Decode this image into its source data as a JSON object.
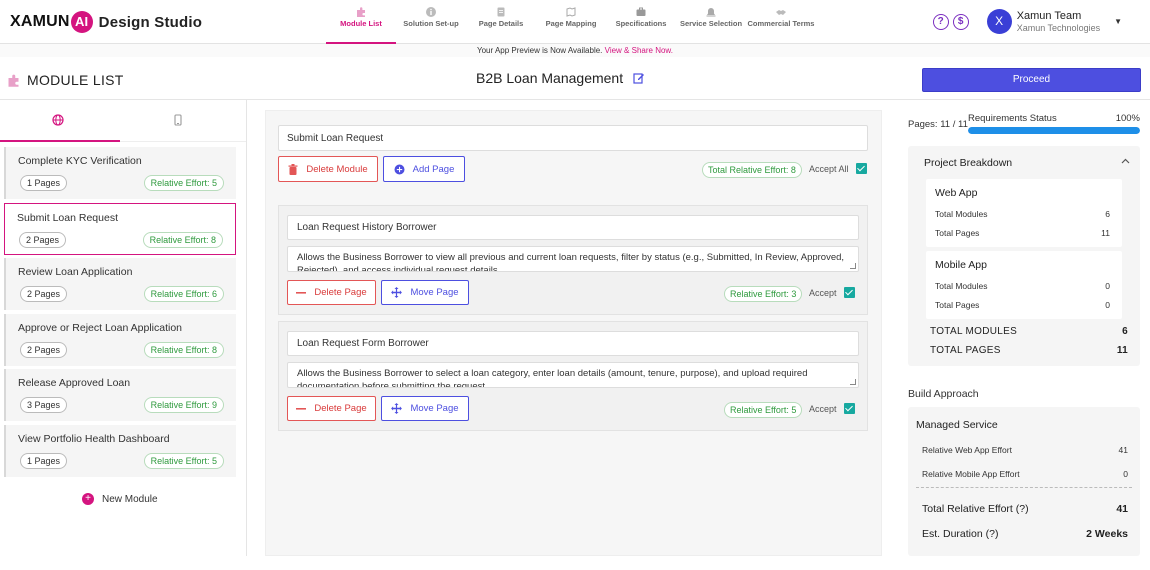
{
  "brand": {
    "name_part": "XAMUN",
    "ai_part": "AI",
    "suffix": "Design Studio"
  },
  "steps": [
    {
      "label": "Module List",
      "icon": "puzzle-icon",
      "active": true
    },
    {
      "label": "Solution Set-up",
      "icon": "info-icon",
      "active": false
    },
    {
      "label": "Page Details",
      "icon": "document-icon",
      "active": false
    },
    {
      "label": "Page Mapping",
      "icon": "map-icon",
      "active": false
    },
    {
      "label": "Specifications",
      "icon": "briefcase-icon",
      "active": false
    },
    {
      "label": "Service Selection",
      "icon": "bell-icon",
      "active": false
    },
    {
      "label": "Commercial Terms",
      "icon": "handshake-icon",
      "active": false
    }
  ],
  "user": {
    "initial": "X",
    "name": "Xamun Team",
    "org": "Xamun Technologies"
  },
  "banner": {
    "text": "Your App Preview is Now Available.",
    "link": "View & Share Now."
  },
  "header": {
    "module_list_title": "MODULE LIST",
    "project_title": "B2B Loan Management",
    "proceed_label": "Proceed"
  },
  "left": {
    "modules": [
      {
        "name": "Complete KYC Verification",
        "pages": "1 Pages",
        "effort": "Relative Effort: 5"
      },
      {
        "name": "Submit Loan Request",
        "pages": "2 Pages",
        "effort": "Relative Effort: 8"
      },
      {
        "name": "Review Loan Application",
        "pages": "2 Pages",
        "effort": "Relative Effort: 6"
      },
      {
        "name": "Approve or Reject Loan Application",
        "pages": "2 Pages",
        "effort": "Relative Effort: 8"
      },
      {
        "name": "Release Approved Loan",
        "pages": "3 Pages",
        "effort": "Relative Effort: 9"
      },
      {
        "name": "View Portfolio Health Dashboard",
        "pages": "1 Pages",
        "effort": "Relative Effort: 5"
      }
    ],
    "new_module_label": "New Module"
  },
  "editor": {
    "module_name": "Submit Loan Request",
    "delete_module_label": "Delete Module",
    "add_page_label": "Add Page",
    "total_effort": "Total Relative Effort: 8",
    "accept_all_label": "Accept All",
    "pages": [
      {
        "title": "Loan Request History Borrower",
        "description": "Allows the Business Borrower to view all previous and current loan requests, filter by status (e.g., Submitted, In Review, Approved, Rejected), and access individual request details.",
        "delete_label": "Delete Page",
        "move_label": "Move Page",
        "effort": "Relative Effort: 3",
        "accept_label": "Accept"
      },
      {
        "title": "Loan Request Form Borrower",
        "description": "Allows the Business Borrower to select a loan category, enter loan details (amount, tenure, purpose), and upload required documentation before submitting the request.",
        "delete_label": "Delete Page",
        "move_label": "Move Page",
        "effort": "Relative Effort: 5",
        "accept_label": "Accept"
      }
    ]
  },
  "right": {
    "pages_count": "Pages: 11 / 11",
    "req_label": "Requirements Status",
    "req_pct": "100%",
    "req_fraction": 1.0,
    "breakdown_title": "Project Breakdown",
    "web": {
      "title": "Web App",
      "modules_label": "Total Modules",
      "modules": "6",
      "pages_label": "Total Pages",
      "pages": "11"
    },
    "mobile": {
      "title": "Mobile App",
      "modules_label": "Total Modules",
      "modules": "0",
      "pages_label": "Total Pages",
      "pages": "0"
    },
    "total_modules_label": "TOTAL MODULES",
    "total_modules": "6",
    "total_pages_label": "TOTAL PAGES",
    "total_pages": "11",
    "build_approach_label": "Build Approach",
    "managed_service_label": "Managed Service",
    "web_effort_label": "Relative Web App Effort",
    "web_effort": "41",
    "mobile_effort_label": "Relative Mobile App Effort",
    "mobile_effort": "0",
    "total_effort_label": "Total Relative Effort (?)",
    "total_effort": "41",
    "duration_label": "Est. Duration (?)",
    "duration": "2 Weeks"
  },
  "colors": {
    "accent": "#d4147f",
    "primary": "#4d4fe0",
    "success": "#2f9a3e",
    "check": "#17a9a0"
  }
}
